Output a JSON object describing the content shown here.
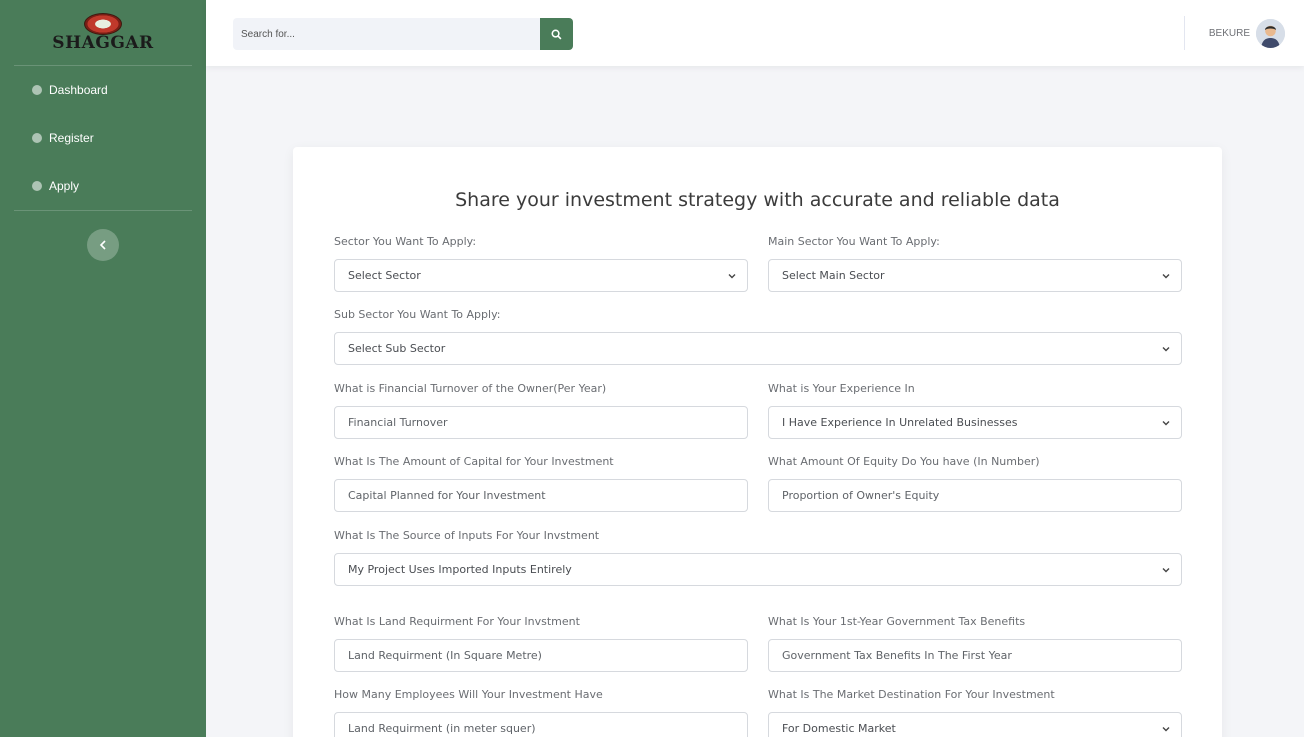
{
  "brand": {
    "logo_text": "SHAGGAR"
  },
  "sidebar": {
    "items": [
      {
        "label": "Dashboard"
      },
      {
        "label": "Register"
      },
      {
        "label": "Apply"
      }
    ]
  },
  "topbar": {
    "search_placeholder": "Search for...",
    "username": "BEKURE"
  },
  "form": {
    "title": "Share your investment strategy with accurate and reliable data",
    "sector": {
      "label": "Sector You Want To Apply:",
      "value": "Select Sector"
    },
    "main_sector": {
      "label": "Main Sector You Want To Apply:",
      "value": "Select Main Sector"
    },
    "sub_sector": {
      "label": "Sub Sector You Want To Apply:",
      "value": "Select Sub Sector"
    },
    "turnover": {
      "label": "What is Financial Turnover of the Owner(Per Year)",
      "placeholder": "Financial Turnover"
    },
    "experience": {
      "label": "What is Your Experience In",
      "value": "I Have Experience In Unrelated Businesses"
    },
    "capital": {
      "label": "What Is The Amount of Capital for Your Investment",
      "placeholder": "Capital Planned for Your Investment"
    },
    "equity": {
      "label": "What Amount Of Equity Do You have (In Number)",
      "placeholder": "Proportion of Owner's Equity"
    },
    "inputs_source": {
      "label": "What Is The Source of Inputs For Your Invstment",
      "value": "My Project Uses Imported Inputs Entirely"
    },
    "land": {
      "label": "What Is Land Requirment For Your Invstment",
      "placeholder": "Land Requirment (In Square Metre)"
    },
    "tax_benefits": {
      "label": "What Is Your 1st-Year Government Tax Benefits",
      "placeholder": "Government Tax Benefits In The First Year"
    },
    "employees": {
      "label": "How Many Employees Will Your Investment Have",
      "placeholder": "Land Requirment (in meter squer)"
    },
    "market": {
      "label": "What Is The Market Destination For Your Investment",
      "value": "For Domestic Market"
    }
  },
  "colors": {
    "accent": "#4a7c59",
    "background": "#f4f5f8"
  }
}
